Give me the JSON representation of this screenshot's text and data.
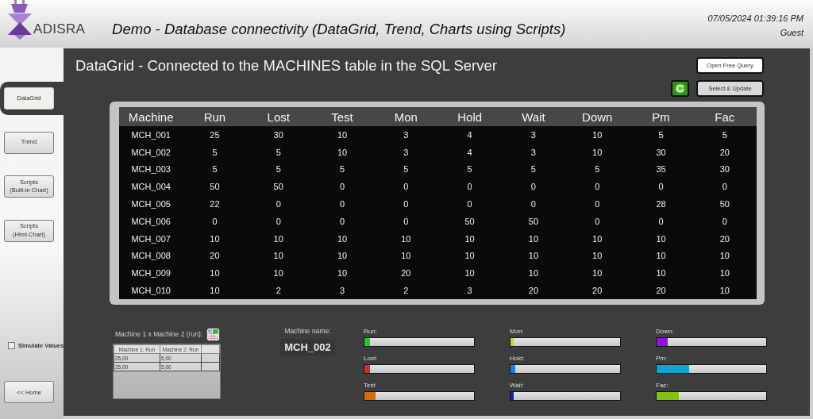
{
  "header": {
    "brand": "ADISRA",
    "title": "Demo - Database connectivity (DataGrid, Trend, Charts using Scripts)",
    "datetime": "07/05/2024 01:39:16 PM",
    "user": "Guest"
  },
  "sidebar": {
    "items": [
      {
        "label": "DataGrid",
        "selected": true
      },
      {
        "label": "Trend",
        "selected": false
      },
      {
        "label": "Scripts",
        "sublabel": "(Built-in Chart)",
        "selected": false
      },
      {
        "label": "Scripts",
        "sublabel": "(Html Chart)",
        "selected": false
      }
    ],
    "simulate": {
      "label": "Simulate Values",
      "checked": false
    },
    "home_button": "<< Home"
  },
  "main": {
    "title": "DataGrid - Connected to the MACHINES table in the SQL Server",
    "open_query_button": "Open Free Query",
    "select_update_button": "Select & Update"
  },
  "table": {
    "columns": [
      "Machine",
      "Run",
      "Lost",
      "Test",
      "Mon",
      "Hold",
      "Wait",
      "Down",
      "Pm",
      "Fac"
    ],
    "rows": [
      [
        "MCH_001",
        "25",
        "30",
        "10",
        "3",
        "4",
        "3",
        "10",
        "5",
        "5"
      ],
      [
        "MCH_002",
        "5",
        "5",
        "10",
        "3",
        "4",
        "3",
        "10",
        "30",
        "20"
      ],
      [
        "MCH_003",
        "5",
        "5",
        "5",
        "5",
        "5",
        "5",
        "5",
        "35",
        "30"
      ],
      [
        "MCH_004",
        "50",
        "50",
        "0",
        "0",
        "0",
        "0",
        "0",
        "0",
        "0"
      ],
      [
        "MCH_005",
        "22",
        "0",
        "0",
        "0",
        "0",
        "0",
        "0",
        "28",
        "50"
      ],
      [
        "MCH_006",
        "0",
        "0",
        "0",
        "0",
        "50",
        "50",
        "0",
        "0",
        "0"
      ],
      [
        "MCH_007",
        "10",
        "10",
        "10",
        "10",
        "10",
        "10",
        "10",
        "10",
        "20"
      ],
      [
        "MCH_008",
        "20",
        "10",
        "10",
        "10",
        "10",
        "10",
        "10",
        "10",
        "10"
      ],
      [
        "MCH_009",
        "10",
        "10",
        "10",
        "20",
        "10",
        "10",
        "10",
        "10",
        "10"
      ],
      [
        "MCH_010",
        "10",
        "2",
        "3",
        "2",
        "3",
        "20",
        "20",
        "20",
        "10"
      ]
    ]
  },
  "comparison": {
    "label": "Machine 1 x Machine 2 (run):",
    "columns": [
      "Machine 1: Run",
      "Machine 2: Run"
    ],
    "rows": [
      [
        "25,00",
        "5,00"
      ],
      [
        "25,00",
        "5,00"
      ]
    ]
  },
  "machine_name": {
    "label": "Machine name:",
    "value": "MCH_002"
  },
  "meters": [
    {
      "label": "Run:",
      "level": 0.05,
      "color": "#22cc22"
    },
    {
      "label": "Lost:",
      "level": 0.05,
      "color": "#c03434"
    },
    {
      "label": "Test",
      "level": 0.1,
      "color": "#d8680e"
    },
    {
      "label": "Mon:",
      "level": 0.03,
      "color": "#c8d41e"
    },
    {
      "label": "Hold:",
      "level": 0.04,
      "color": "#1e7ee0"
    },
    {
      "label": "Wait:",
      "level": 0.03,
      "color": "#1020b0"
    },
    {
      "label": "Down:",
      "level": 0.1,
      "color": "#8a12e0"
    },
    {
      "label": "Pm:",
      "level": 0.3,
      "color": "#12a4d2"
    },
    {
      "label": "Fac:",
      "level": 0.2,
      "color": "#84c212"
    }
  ]
}
